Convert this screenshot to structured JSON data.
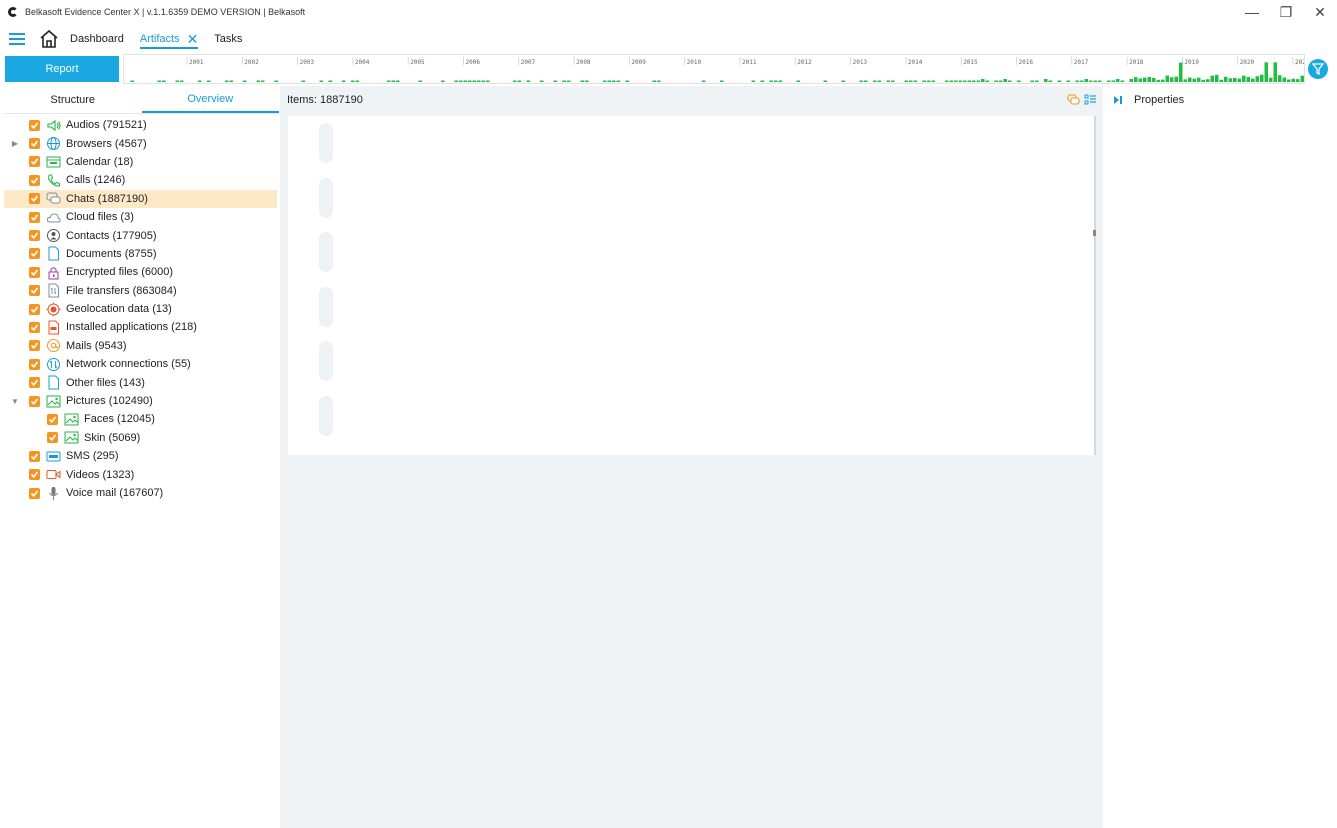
{
  "window": {
    "title": "Belkasoft Evidence Center X | v.1.1.6359 DEMO VERSION | Belkasoft",
    "minimize": "—",
    "restore": "❐",
    "close": "✕"
  },
  "tabs": [
    {
      "label": "Dashboard"
    },
    {
      "label": "Artifacts",
      "active": true
    },
    {
      "label": "Tasks"
    }
  ],
  "toolbar": {
    "report_label": "Report"
  },
  "timeline": {
    "years": [
      "2001",
      "2002",
      "2003",
      "2004",
      "2005",
      "2006",
      "2007",
      "2008",
      "2009",
      "2010",
      "2011",
      "2012",
      "2013",
      "2014",
      "2015",
      "2016",
      "2017",
      "2018",
      "2019",
      "2020",
      "2021"
    ],
    "bar_color": "#1fbf3f"
  },
  "left_panel": {
    "tabs": [
      {
        "label": "Structure"
      },
      {
        "label": "Overview",
        "active": true
      }
    ],
    "tree": [
      {
        "label": "Audios (791521)",
        "icon": "speaker-icon"
      },
      {
        "label": "Browsers (4567)",
        "icon": "globe-icon",
        "expandable": true
      },
      {
        "label": "Calendar (18)",
        "icon": "calendar-icon"
      },
      {
        "label": "Calls (1246)",
        "icon": "phone-icon"
      },
      {
        "label": "Chats (1887190)",
        "icon": "chat-icon",
        "selected": true
      },
      {
        "label": "Cloud files (3)",
        "icon": "cloud-icon"
      },
      {
        "label": "Contacts (177905)",
        "icon": "contact-icon"
      },
      {
        "label": "Documents (8755)",
        "icon": "document-icon"
      },
      {
        "label": "Encrypted files (6000)",
        "icon": "lock-icon"
      },
      {
        "label": "File transfers (863084)",
        "icon": "file-transfer-icon"
      },
      {
        "label": "Geolocation data (13)",
        "icon": "location-icon"
      },
      {
        "label": "Installed applications (218)",
        "icon": "app-icon"
      },
      {
        "label": "Mails (9543)",
        "icon": "at-icon"
      },
      {
        "label": "Network connections (55)",
        "icon": "network-icon"
      },
      {
        "label": "Other files (143)",
        "icon": "file-icon"
      },
      {
        "label": "Pictures (102490)",
        "icon": "picture-icon",
        "expanded": true
      },
      {
        "label": "Faces (12045)",
        "icon": "picture-icon",
        "child": true
      },
      {
        "label": "Skin (5069)",
        "icon": "picture-icon",
        "child": true
      },
      {
        "label": "SMS (295)",
        "icon": "sms-icon"
      },
      {
        "label": "Videos (1323)",
        "icon": "video-icon"
      },
      {
        "label": "Voice mail (167607)",
        "icon": "microphone-icon"
      }
    ]
  },
  "center": {
    "items_label": "Items: 1887190"
  },
  "right_panel": {
    "title": "Properties"
  },
  "colors": {
    "accent": "#1a9bd7",
    "checkbox": "#f29621",
    "selected_row": "#fde9c8"
  }
}
